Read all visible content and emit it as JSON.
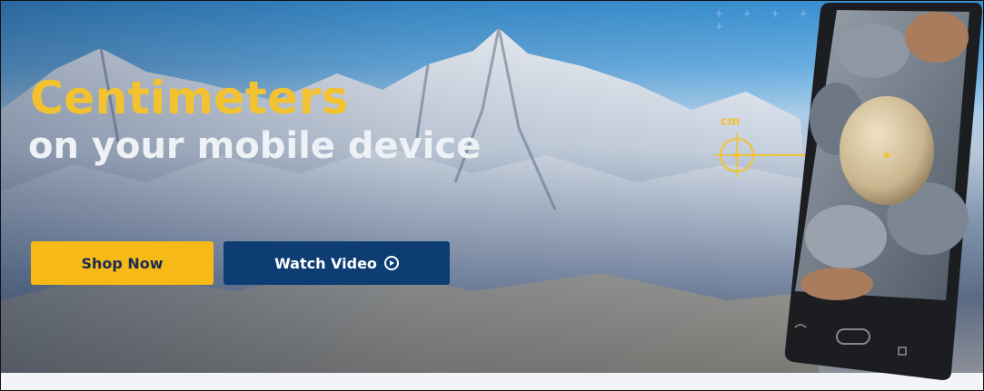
{
  "hero": {
    "headline_line1": "Centimeters",
    "headline_line2_light": "on your ",
    "headline_line2_bold": "mobile device"
  },
  "buttons": {
    "shop": "Shop Now",
    "video": "Watch Video"
  },
  "measure": {
    "unit_label": "cm"
  },
  "decor": {
    "plus_row": "+ + + + +",
    "plus_single": "+"
  },
  "colors": {
    "accent_yellow": "#f6b916",
    "headline_yellow": "#f2c230",
    "navy": "#0e3d74",
    "phone_body": "#1c1d20"
  },
  "icons": {
    "play": "play-circle-icon",
    "crosshair": "crosshair-icon",
    "back": "back-icon",
    "home": "home-button-icon",
    "recent": "recent-apps-icon"
  }
}
